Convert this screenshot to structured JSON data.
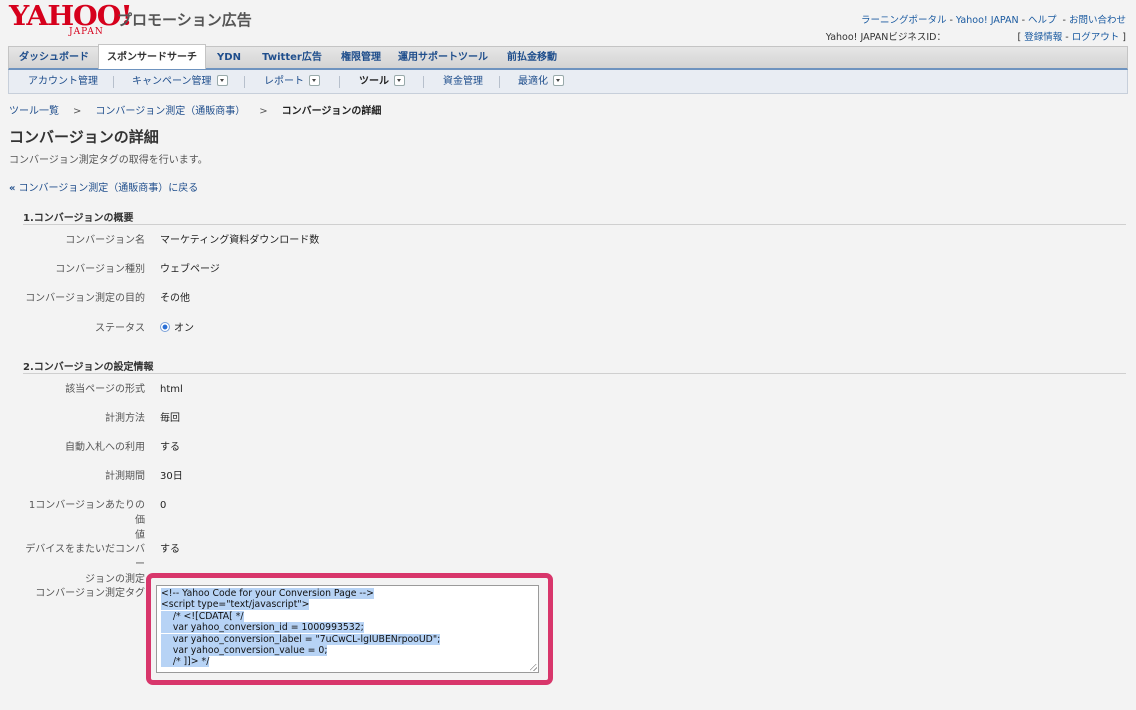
{
  "header": {
    "logo_text": "YAHOO!",
    "logo_sub": "JAPAN",
    "product_name": "プロモーション広告",
    "links": [
      "ラーニングポータル",
      "Yahoo! JAPAN",
      "ヘルプ",
      "お問い合わせ"
    ],
    "business_id_label": "Yahoo! JAPANビジネスID：",
    "account_links": [
      "登録情報",
      "ログアウト"
    ]
  },
  "main_nav": {
    "tabs": [
      "ダッシュボード",
      "スポンサードサーチ",
      "YDN",
      "Twitter広告",
      "権限管理",
      "運用サポートツール",
      "前払金移動"
    ],
    "active_index": 1
  },
  "sub_nav": {
    "items": [
      {
        "label": "アカウント管理",
        "dropdown": false
      },
      {
        "label": "キャンペーン管理",
        "dropdown": true
      },
      {
        "label": "レポート",
        "dropdown": true
      },
      {
        "label": "ツール",
        "dropdown": true
      },
      {
        "label": "資金管理",
        "dropdown": false
      },
      {
        "label": "最適化",
        "dropdown": true
      }
    ],
    "current_index": 3
  },
  "breadcrumb": {
    "items": [
      "ツール一覧",
      "コンバージョン測定（通販商事）",
      "コンバージョンの詳細"
    ],
    "separator": ">"
  },
  "page": {
    "title": "コンバージョンの詳細",
    "description": "コンバージョン測定タグの取得を行います。",
    "back_link": "コンバージョン測定（通販商事）に戻る"
  },
  "section1": {
    "title": "1.コンバージョンの概要",
    "rows": [
      {
        "label": "コンバージョン名",
        "value": "マーケティング資料ダウンロード数"
      },
      {
        "label": "コンバージョン種別",
        "value": "ウェブページ"
      },
      {
        "label": "コンバージョン測定の目的",
        "value": "その他"
      },
      {
        "label": "ステータス",
        "value": "オン"
      }
    ]
  },
  "section2": {
    "title": "2.コンバージョンの設定情報",
    "rows": [
      {
        "label": "該当ページの形式",
        "value": "html"
      },
      {
        "label": "計測方法",
        "value": "毎回"
      },
      {
        "label": "自動入札への利用",
        "value": "する"
      },
      {
        "label": "計測期間",
        "value": "30日"
      },
      {
        "label_lines": [
          "1コンバージョンあたりの価",
          "値"
        ],
        "value": "0"
      },
      {
        "label_lines": [
          "デバイスをまたいだコンバー",
          "ジョンの測定"
        ],
        "value": "する"
      }
    ],
    "tag_label": "コンバージョン測定タグ",
    "tag_code_lines": [
      "<!-- Yahoo Code for your Conversion Page -->",
      "<script type=\"text/javascript\">",
      "    /* <![CDATA[ */",
      "    var yahoo_conversion_id = 1000993532;",
      "    var yahoo_conversion_label = \"7uCwCL-lgIUBENrpooUD\";",
      "    var yahoo_conversion_value = 0;",
      "    /* ]]> */"
    ]
  },
  "colors": {
    "brand_red": "#d6001c",
    "link_blue": "#1f4e8c",
    "highlight_pink": "#d8366b",
    "selection_blue": "#b7d3f5"
  }
}
